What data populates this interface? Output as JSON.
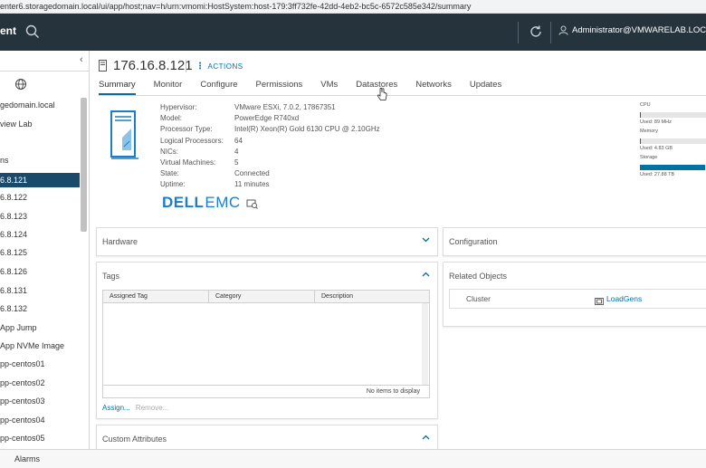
{
  "browser": {
    "url": "enter6.storagedomain.local/ui/app/host;nav=h/urn:vmomi:HostSystem:host-179:3ff732fe-42dd-4eb2-bc5c-6572c585e342/summary"
  },
  "topnav": {
    "app_title": "ent",
    "user": "Administrator@VMWARELAB.LOCAL"
  },
  "sidebar": {
    "items": [
      {
        "label": "gedomain.local"
      },
      {
        "label": "view Lab"
      },
      {
        "label": "ns"
      },
      {
        "label": "6.8.121",
        "selected": true
      },
      {
        "label": "6.8.122"
      },
      {
        "label": "6.8.123"
      },
      {
        "label": "6.8.124"
      },
      {
        "label": "6.8.125"
      },
      {
        "label": "6.8.126"
      },
      {
        "label": "6.8.131"
      },
      {
        "label": "6.8.132"
      },
      {
        "label": "App Jump"
      },
      {
        "label": "App NVMe Image"
      },
      {
        "label": "pp-centos01"
      },
      {
        "label": "pp-centos02"
      },
      {
        "label": "pp-centos03"
      },
      {
        "label": "pp-centos04"
      },
      {
        "label": "pp-centos05"
      }
    ]
  },
  "host": {
    "title": "176.16.8.121",
    "actions_label": "ACTIONS"
  },
  "tabs": [
    "Summary",
    "Monitor",
    "Configure",
    "Permissions",
    "VMs",
    "Datastores",
    "Networks",
    "Updates"
  ],
  "summary": {
    "labels": [
      "Hypervisor:",
      "Model:",
      "Processor Type:",
      "Logical Processors:",
      "NICs:",
      "Virtual Machines:",
      "State:",
      "Uptime:"
    ],
    "values": [
      "VMware ESXi, 7.0.2, 17867351",
      "PowerEdge R740xd",
      "Intel(R) Xeon(R) Gold 6130 CPU @ 2.10GHz",
      "64",
      "4",
      "5",
      "Connected",
      "11 minutes"
    ],
    "vendor_logo": {
      "part1": "DELL",
      "part2": "EMC"
    }
  },
  "capacity": [
    {
      "label": "CPU",
      "used": "Used: 89 MHz",
      "fill": 0.01
    },
    {
      "label": "Memory",
      "used": "Used: 4.83 GB",
      "fill": 0.02
    },
    {
      "label": "Storage",
      "used": "Used: 27.88 TB",
      "fill": 0.98
    }
  ],
  "panels": {
    "hardware": "Hardware",
    "configuration": "Configuration",
    "tags": {
      "title": "Tags",
      "columns": [
        "Assigned Tag",
        "Category",
        "Description"
      ],
      "empty": "No items to display",
      "assign": "Assign...",
      "remove": "Remove..."
    },
    "related": {
      "title": "Related Objects",
      "key": "Cluster",
      "value": "LoadGens"
    },
    "custom_attributes": "Custom Attributes"
  },
  "bottom": {
    "alarms": "Alarms"
  },
  "colors": {
    "nav": "#25333d",
    "accent": "#0072a3",
    "selection": "#1a4a6b"
  }
}
